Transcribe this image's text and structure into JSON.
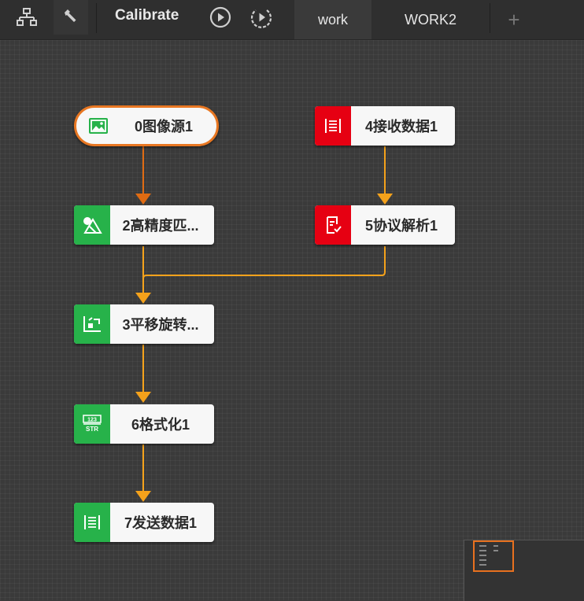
{
  "toolbar": {
    "calibrate_label": "Calibrate",
    "icons": [
      "process-tree-icon",
      "wrench-icon",
      "run-once-icon",
      "run-loop-icon"
    ],
    "add_label": "+"
  },
  "tabs": [
    {
      "label": "work",
      "active": true
    },
    {
      "label": "WORK2",
      "active": false
    }
  ],
  "nodes": {
    "n0": {
      "label": "0图像源1",
      "icon": "image-source-icon",
      "color": "#27b24a"
    },
    "n2": {
      "label": "2高精度匹...",
      "icon": "shape-match-icon",
      "color": "#27b24a"
    },
    "n3": {
      "label": "3平移旋转...",
      "icon": "translate-rotate-icon",
      "color": "#27b24a"
    },
    "n6": {
      "label": "6格式化1",
      "icon": "format-str-icon",
      "color": "#27b24a"
    },
    "n7": {
      "label": "7发送数据1",
      "icon": "send-data-icon",
      "color": "#27b24a"
    },
    "n4": {
      "label": "4接收数据1",
      "icon": "receive-data-icon",
      "color": "#e60012"
    },
    "n5": {
      "label": "5协议解析1",
      "icon": "protocol-parse-icon",
      "color": "#e60012"
    }
  },
  "colors": {
    "link": "#f5a21b",
    "link_active": "#e06b12",
    "source_border": "#e87722",
    "canvas": "#3a3a3a"
  }
}
